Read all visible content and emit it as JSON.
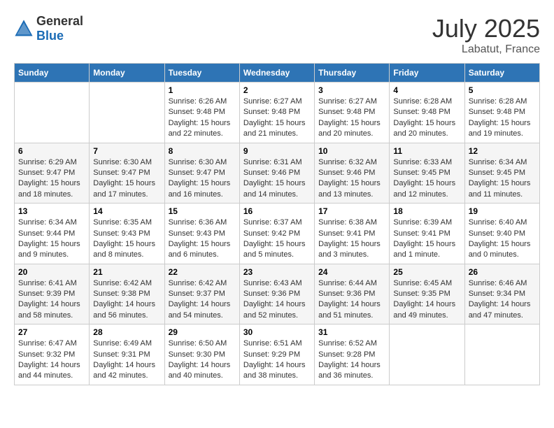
{
  "header": {
    "logo_general": "General",
    "logo_blue": "Blue",
    "month": "July 2025",
    "location": "Labatut, France"
  },
  "days_of_week": [
    "Sunday",
    "Monday",
    "Tuesday",
    "Wednesday",
    "Thursday",
    "Friday",
    "Saturday"
  ],
  "weeks": [
    [
      {
        "day": "",
        "info": ""
      },
      {
        "day": "",
        "info": ""
      },
      {
        "day": "1",
        "info": "Sunrise: 6:26 AM\nSunset: 9:48 PM\nDaylight: 15 hours\nand 22 minutes."
      },
      {
        "day": "2",
        "info": "Sunrise: 6:27 AM\nSunset: 9:48 PM\nDaylight: 15 hours\nand 21 minutes."
      },
      {
        "day": "3",
        "info": "Sunrise: 6:27 AM\nSunset: 9:48 PM\nDaylight: 15 hours\nand 20 minutes."
      },
      {
        "day": "4",
        "info": "Sunrise: 6:28 AM\nSunset: 9:48 PM\nDaylight: 15 hours\nand 20 minutes."
      },
      {
        "day": "5",
        "info": "Sunrise: 6:28 AM\nSunset: 9:48 PM\nDaylight: 15 hours\nand 19 minutes."
      }
    ],
    [
      {
        "day": "6",
        "info": "Sunrise: 6:29 AM\nSunset: 9:47 PM\nDaylight: 15 hours\nand 18 minutes."
      },
      {
        "day": "7",
        "info": "Sunrise: 6:30 AM\nSunset: 9:47 PM\nDaylight: 15 hours\nand 17 minutes."
      },
      {
        "day": "8",
        "info": "Sunrise: 6:30 AM\nSunset: 9:47 PM\nDaylight: 15 hours\nand 16 minutes."
      },
      {
        "day": "9",
        "info": "Sunrise: 6:31 AM\nSunset: 9:46 PM\nDaylight: 15 hours\nand 14 minutes."
      },
      {
        "day": "10",
        "info": "Sunrise: 6:32 AM\nSunset: 9:46 PM\nDaylight: 15 hours\nand 13 minutes."
      },
      {
        "day": "11",
        "info": "Sunrise: 6:33 AM\nSunset: 9:45 PM\nDaylight: 15 hours\nand 12 minutes."
      },
      {
        "day": "12",
        "info": "Sunrise: 6:34 AM\nSunset: 9:45 PM\nDaylight: 15 hours\nand 11 minutes."
      }
    ],
    [
      {
        "day": "13",
        "info": "Sunrise: 6:34 AM\nSunset: 9:44 PM\nDaylight: 15 hours\nand 9 minutes."
      },
      {
        "day": "14",
        "info": "Sunrise: 6:35 AM\nSunset: 9:43 PM\nDaylight: 15 hours\nand 8 minutes."
      },
      {
        "day": "15",
        "info": "Sunrise: 6:36 AM\nSunset: 9:43 PM\nDaylight: 15 hours\nand 6 minutes."
      },
      {
        "day": "16",
        "info": "Sunrise: 6:37 AM\nSunset: 9:42 PM\nDaylight: 15 hours\nand 5 minutes."
      },
      {
        "day": "17",
        "info": "Sunrise: 6:38 AM\nSunset: 9:41 PM\nDaylight: 15 hours\nand 3 minutes."
      },
      {
        "day": "18",
        "info": "Sunrise: 6:39 AM\nSunset: 9:41 PM\nDaylight: 15 hours\nand 1 minute."
      },
      {
        "day": "19",
        "info": "Sunrise: 6:40 AM\nSunset: 9:40 PM\nDaylight: 15 hours\nand 0 minutes."
      }
    ],
    [
      {
        "day": "20",
        "info": "Sunrise: 6:41 AM\nSunset: 9:39 PM\nDaylight: 14 hours\nand 58 minutes."
      },
      {
        "day": "21",
        "info": "Sunrise: 6:42 AM\nSunset: 9:38 PM\nDaylight: 14 hours\nand 56 minutes."
      },
      {
        "day": "22",
        "info": "Sunrise: 6:42 AM\nSunset: 9:37 PM\nDaylight: 14 hours\nand 54 minutes."
      },
      {
        "day": "23",
        "info": "Sunrise: 6:43 AM\nSunset: 9:36 PM\nDaylight: 14 hours\nand 52 minutes."
      },
      {
        "day": "24",
        "info": "Sunrise: 6:44 AM\nSunset: 9:36 PM\nDaylight: 14 hours\nand 51 minutes."
      },
      {
        "day": "25",
        "info": "Sunrise: 6:45 AM\nSunset: 9:35 PM\nDaylight: 14 hours\nand 49 minutes."
      },
      {
        "day": "26",
        "info": "Sunrise: 6:46 AM\nSunset: 9:34 PM\nDaylight: 14 hours\nand 47 minutes."
      }
    ],
    [
      {
        "day": "27",
        "info": "Sunrise: 6:47 AM\nSunset: 9:32 PM\nDaylight: 14 hours\nand 44 minutes."
      },
      {
        "day": "28",
        "info": "Sunrise: 6:49 AM\nSunset: 9:31 PM\nDaylight: 14 hours\nand 42 minutes."
      },
      {
        "day": "29",
        "info": "Sunrise: 6:50 AM\nSunset: 9:30 PM\nDaylight: 14 hours\nand 40 minutes."
      },
      {
        "day": "30",
        "info": "Sunrise: 6:51 AM\nSunset: 9:29 PM\nDaylight: 14 hours\nand 38 minutes."
      },
      {
        "day": "31",
        "info": "Sunrise: 6:52 AM\nSunset: 9:28 PM\nDaylight: 14 hours\nand 36 minutes."
      },
      {
        "day": "",
        "info": ""
      },
      {
        "day": "",
        "info": ""
      }
    ]
  ]
}
